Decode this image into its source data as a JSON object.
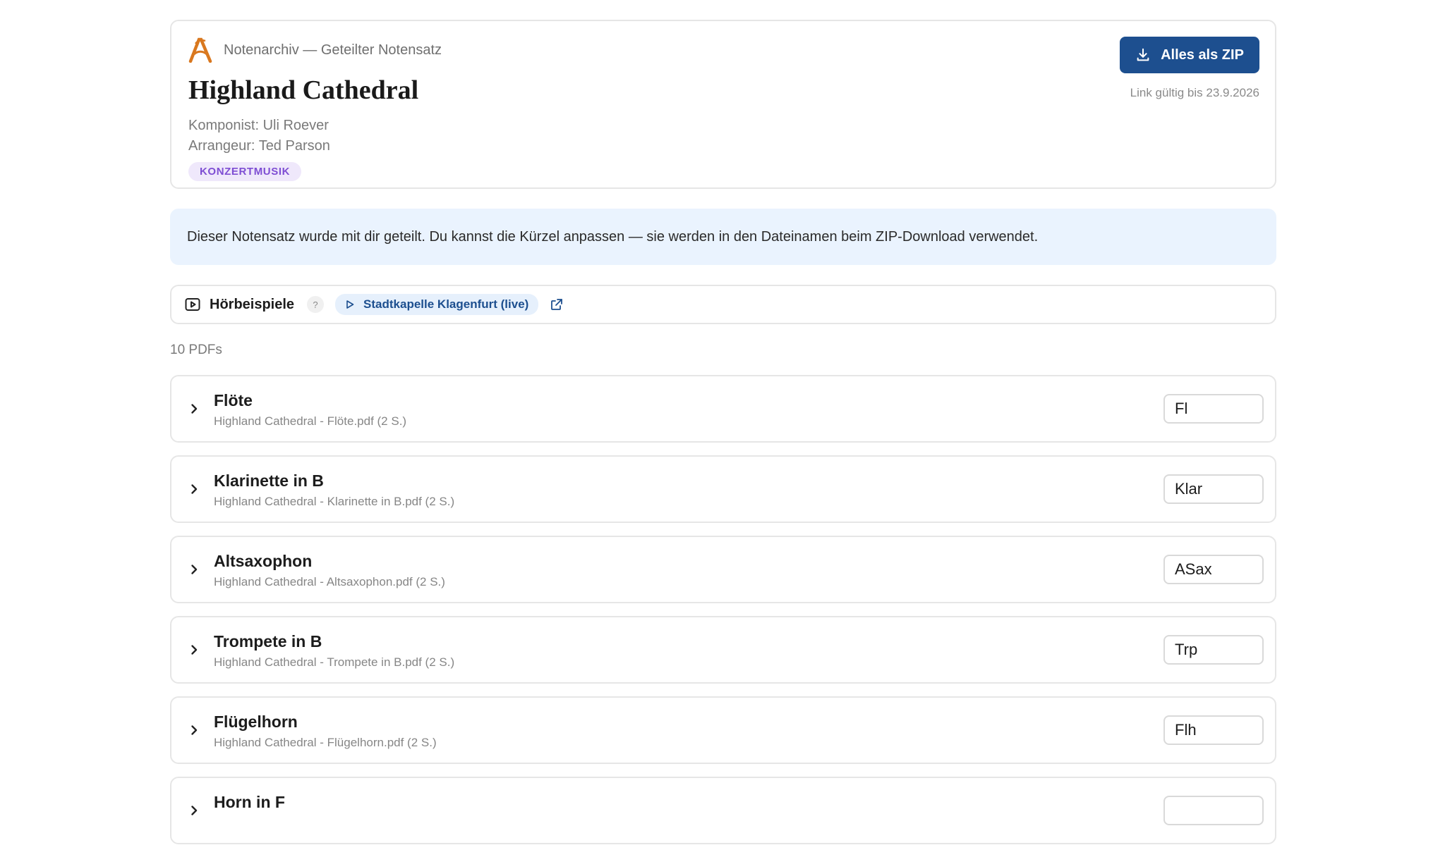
{
  "header": {
    "brand": "Notenarchiv — Geteilter Notensatz",
    "title": "Highland Cathedral",
    "composer": "Komponist: Uli Roever",
    "arranger": "Arrangeur: Ted Parson",
    "tag": "KONZERTMUSIK",
    "zip_button": "Alles als ZIP",
    "link_valid": "Link gültig bis 23.9.2026"
  },
  "banner": {
    "text": "Dieser Notensatz wurde mit dir geteilt. Du kannst die Kürzel anpassen — sie werden in den Dateinamen beim ZIP-Download verwendet."
  },
  "audio": {
    "title": "Hörbeispiele",
    "help": "?",
    "link_label": "Stadtkapelle Klagenfurt (live)"
  },
  "pdf_count": "10 PDFs",
  "pdfs": [
    {
      "name": "Flöte",
      "file": "Highland Cathedral - Flöte.pdf (2 S.)",
      "abbr": "Fl"
    },
    {
      "name": "Klarinette in B",
      "file": "Highland Cathedral - Klarinette in B.pdf (2 S.)",
      "abbr": "Klar"
    },
    {
      "name": "Altsaxophon",
      "file": "Highland Cathedral - Altsaxophon.pdf (2 S.)",
      "abbr": "ASax"
    },
    {
      "name": "Trompete in B",
      "file": "Highland Cathedral - Trompete in B.pdf (2 S.)",
      "abbr": "Trp"
    },
    {
      "name": "Flügelhorn",
      "file": "Highland Cathedral - Flügelhorn.pdf (2 S.)",
      "abbr": "Flh"
    },
    {
      "name": "Horn in F",
      "file": "",
      "abbr": ""
    }
  ],
  "colors": {
    "accent": "#1d4f8f",
    "brand_logo": "#d9781f",
    "tag_bg": "#efe8fb",
    "tag_text": "#7e4ed3",
    "banner_bg": "#eaf3fe"
  },
  "icons": {
    "brand": "music-a-logo",
    "zip": "download-icon",
    "audio": "play-box-icon",
    "audio_link": "play-icon",
    "external": "external-link-icon",
    "row": "chevron-right-icon"
  }
}
